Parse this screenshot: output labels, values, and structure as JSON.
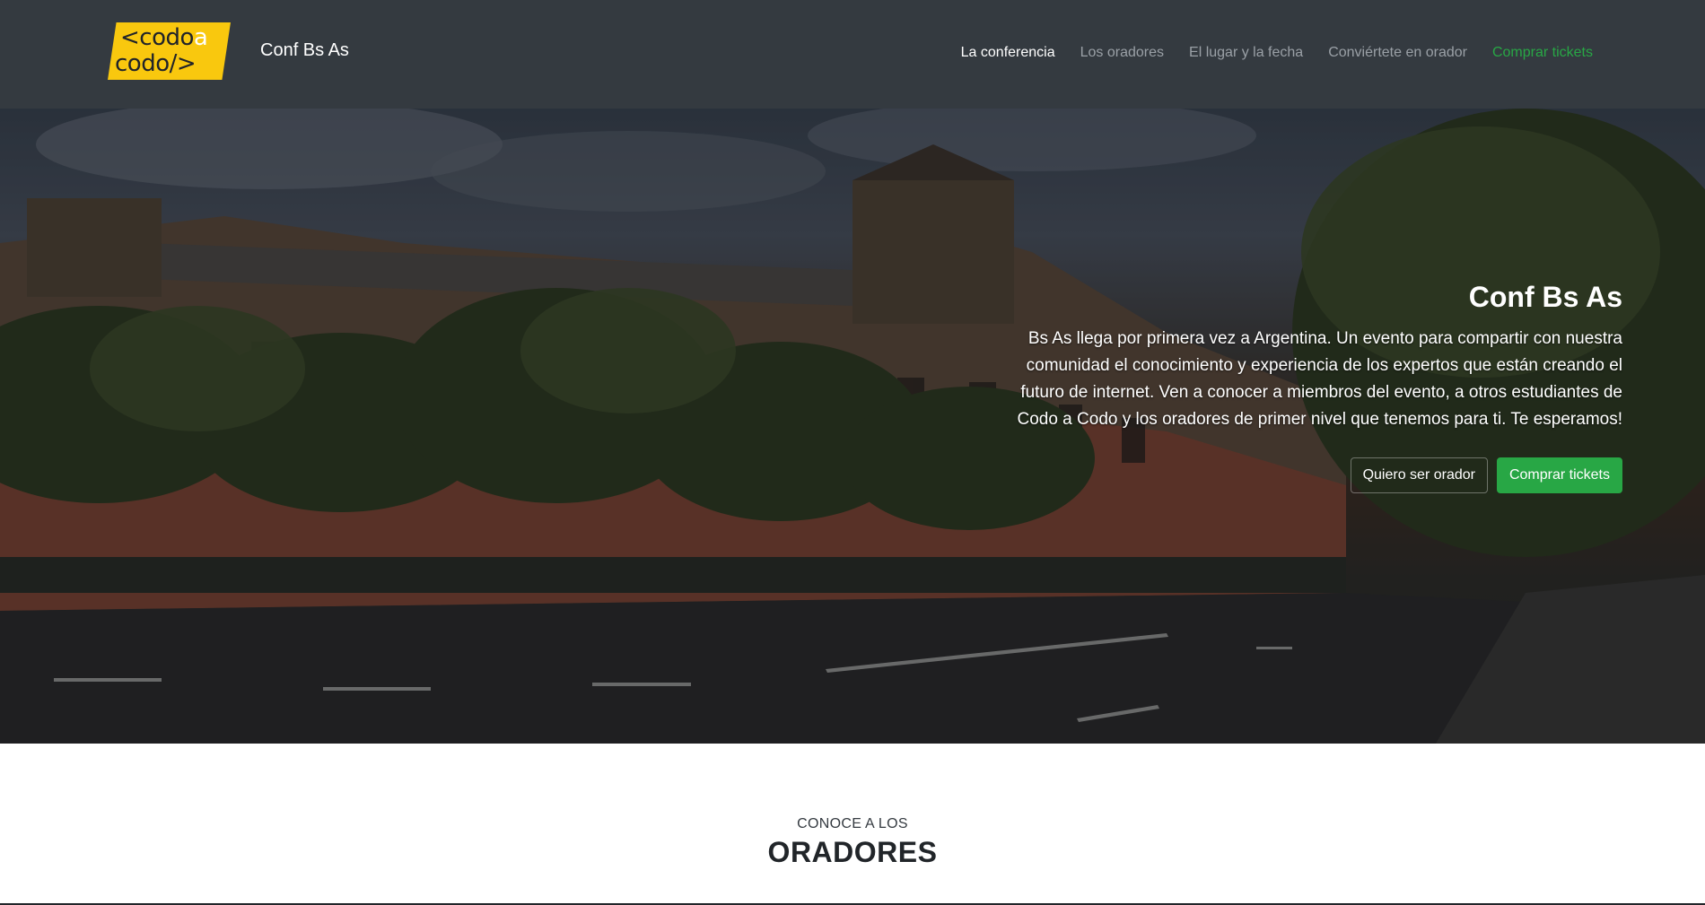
{
  "brand": {
    "logo_line1_a": "<codo",
    "logo_line1_b": "a",
    "logo_line2": "codo/>",
    "name": "Conf Bs As"
  },
  "nav": {
    "items": [
      {
        "label": "La conferencia",
        "state": "active"
      },
      {
        "label": "Los oradores",
        "state": "normal"
      },
      {
        "label": "El lugar y la fecha",
        "state": "normal"
      },
      {
        "label": "Conviértete en orador",
        "state": "normal"
      },
      {
        "label": "Comprar tickets",
        "state": "highlight"
      }
    ]
  },
  "hero": {
    "title": "Conf Bs As",
    "text": "Bs As llega por primera vez a Argentina. Un evento para compartir con nuestra comunidad el conocimiento y experiencia de los expertos que están creando el futuro de internet. Ven a conocer a miembros del evento, a otros estudiantes de Codo a Codo y los oradores de primer nivel que tenemos para ti. Te esperamos!",
    "btn_secondary": "Quiero ser orador",
    "btn_primary": "Comprar tickets"
  },
  "speakers": {
    "kicker": "CONOCE A LOS",
    "title": "ORADORES"
  },
  "colors": {
    "navbar": "#343a40",
    "accent_green": "#28a745",
    "logo_yellow": "#f9c80e"
  }
}
